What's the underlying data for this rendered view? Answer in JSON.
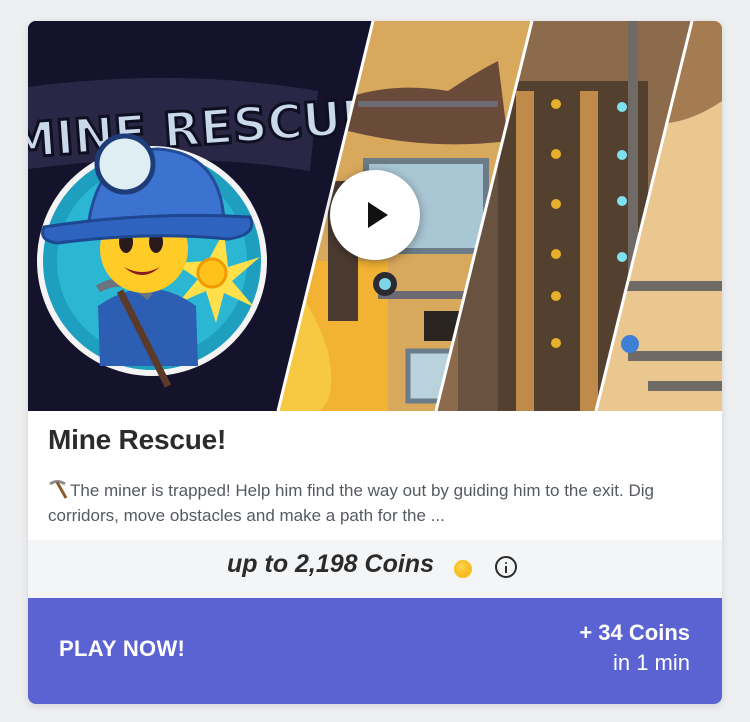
{
  "game": {
    "logo_text": "MINE RESCUE!",
    "title": "Mine Rescue!",
    "description_icon": "pickaxe-icon",
    "description": "The miner is trapped! Help him find the way out by guiding him to the exit. Dig corridors, move obstacles and make a path for the ..."
  },
  "reward": {
    "text": "up to 2,198 Coins",
    "coin_icon": "coin-icon",
    "info_icon": "info-icon"
  },
  "cta": {
    "label": "PLAY NOW!",
    "coins": "+ 34 Coins",
    "time": "in 1 min"
  },
  "colors": {
    "accent": "#5b63d3",
    "coin": "#f2a600",
    "title": "#2b2b2b"
  }
}
